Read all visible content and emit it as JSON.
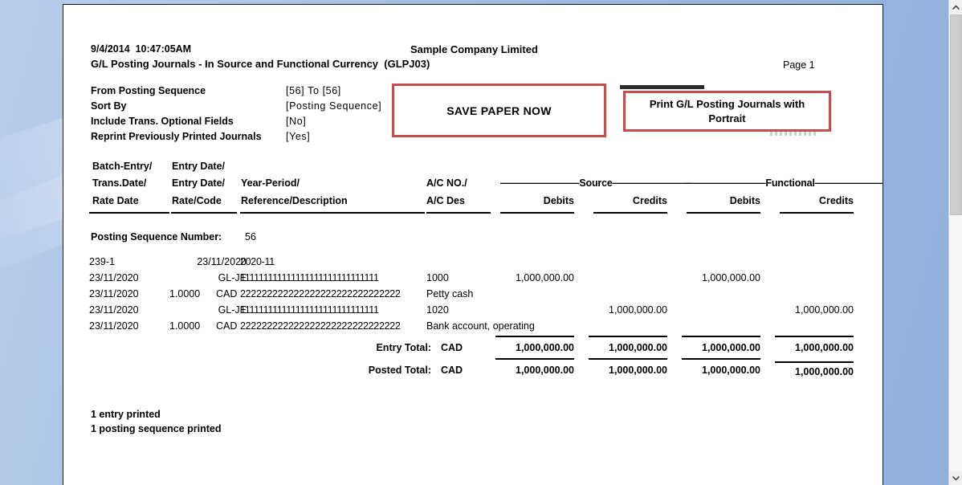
{
  "window": {
    "scrollbar": {
      "up_arrow": "⌃",
      "down_arrow": "⌄"
    }
  },
  "report": {
    "header": {
      "datetime": "9/4/2014  10:47:05AM",
      "company": "Sample Company Limited",
      "title": "G/L Posting Journals - In Source and Functional Currency  (GLPJ03)",
      "page": "Page 1"
    },
    "criteria": [
      {
        "label": "From Posting Sequence",
        "value": "[56]  To  [56]"
      },
      {
        "label": "Sort By",
        "value": "[Posting Sequence]"
      },
      {
        "label": "Include Trans. Optional Fields",
        "value": "[No]"
      },
      {
        "label": "Reprint Previously Printed Journals",
        "value": "[Yes]"
      }
    ],
    "callouts": [
      {
        "name": "save-paper-now",
        "text": "SAVE PAPER NOW"
      },
      {
        "name": "print-portrait",
        "text": "Print G/L Posting Journals with Portrait"
      }
    ],
    "columns": {
      "col1": [
        "Batch-Entry/",
        "Trans.Date/",
        "Rate Date"
      ],
      "col2": [
        "Entry Date/",
        "Entry Date/",
        "Rate/Code"
      ],
      "col3": [
        "Year-Period/",
        "Reference/Description"
      ],
      "col4": [
        "A/C NO./",
        "A/C Des"
      ],
      "source_group": "————————Source————————",
      "functional_group": "————————Functional————————",
      "source_debits": "Debits",
      "source_credits": "Credits",
      "functional_debits": "Debits",
      "functional_credits": "Credits"
    },
    "posting_sequence": {
      "label": "Posting Sequence Number:",
      "value": "56"
    },
    "entry_rows": [
      {
        "col_a": "239-1",
        "col_b": "23/11/2020",
        "reference": "2020-11",
        "account": "",
        "source_debits": "",
        "source_credits": "",
        "functional_debits": "",
        "functional_credits": ""
      },
      {
        "col_a": "23/11/2020",
        "col_b": "GL-JE",
        "reference": "111111111111111111111111111111",
        "account": "1000",
        "source_debits": "1,000,000.00",
        "source_credits": "",
        "functional_debits": "1,000,000.00",
        "functional_credits": ""
      },
      {
        "col_a": "23/11/2020",
        "rate": "1.0000",
        "currency": "CAD",
        "reference": "222222222222222222222222222222",
        "account": "Petty cash",
        "source_debits": "",
        "source_credits": "",
        "functional_debits": "",
        "functional_credits": ""
      },
      {
        "col_a": "23/11/2020",
        "col_b": "GL-JE",
        "reference": "111111111111111111111111111111",
        "account": "1020",
        "source_debits": "",
        "source_credits": "1,000,000.00",
        "functional_debits": "",
        "functional_credits": "1,000,000.00"
      },
      {
        "col_a": "23/11/2020",
        "rate": "1.0000",
        "currency": "CAD",
        "reference": "222222222222222222222222222222",
        "account": "Bank account, operating",
        "source_debits": "",
        "source_credits": "",
        "functional_debits": "",
        "functional_credits": ""
      }
    ],
    "totals": [
      {
        "label": "Entry Total:",
        "currency": "CAD",
        "source_debits": "1,000,000.00",
        "source_credits": "1,000,000.00",
        "functional_debits": "1,000,000.00",
        "functional_credits": "1,000,000.00"
      },
      {
        "label": "Posted Total:",
        "currency": "CAD",
        "source_debits": "1,000,000.00",
        "source_credits": "1,000,000.00",
        "functional_debits": "1,000,000.00",
        "functional_credits": "1,000,000.00"
      }
    ],
    "footer": [
      "1 entry printed",
      "1 posting sequence printed"
    ]
  },
  "colors": {
    "callout_border": "#C0504D",
    "page_background": "#ffffff",
    "desktop": "#9ab7e0"
  }
}
